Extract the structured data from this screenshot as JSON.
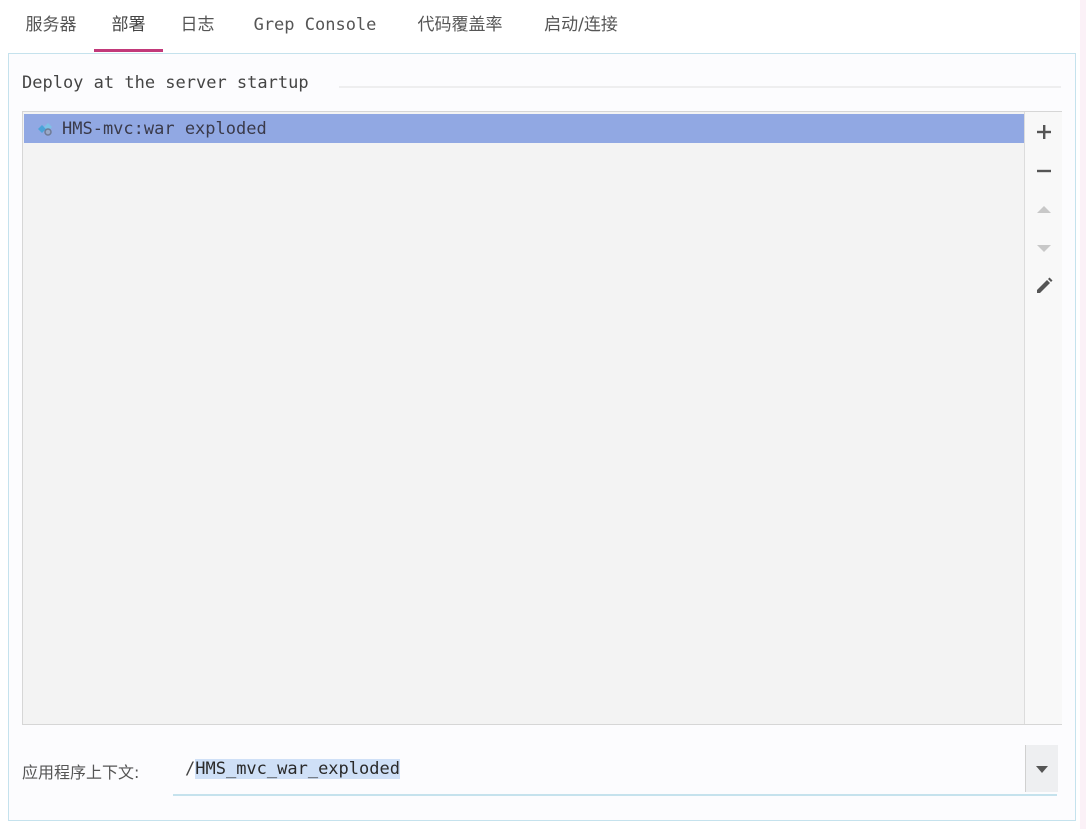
{
  "tabs": [
    {
      "label": "服务器"
    },
    {
      "label": "部署"
    },
    {
      "label": "日志"
    },
    {
      "label": "Grep Console"
    },
    {
      "label": "代码覆盖率"
    },
    {
      "label": "启动/连接"
    }
  ],
  "active_tab": "部署",
  "deploy": {
    "section_title": "Deploy at the server startup",
    "artifacts": [
      {
        "label": "HMS-mvc:war exploded",
        "icon": "artifact-icon",
        "selected": true
      }
    ],
    "toolbar": [
      {
        "icon": "plus-icon",
        "enabled": true
      },
      {
        "icon": "minus-icon",
        "enabled": true
      },
      {
        "icon": "move-up-icon",
        "enabled": false
      },
      {
        "icon": "move-down-icon",
        "enabled": false
      },
      {
        "icon": "edit-pencil-icon",
        "enabled": true
      }
    ]
  },
  "context": {
    "label": "应用程序上下文:",
    "prefix": "/",
    "value": "HMS_mvc_war_exploded"
  },
  "colors": {
    "active_tab_underline": "#c2397a",
    "selected_row": "#91a8e3",
    "panel_border": "#c5e2ed",
    "text_selection": "#cfe0f7"
  }
}
